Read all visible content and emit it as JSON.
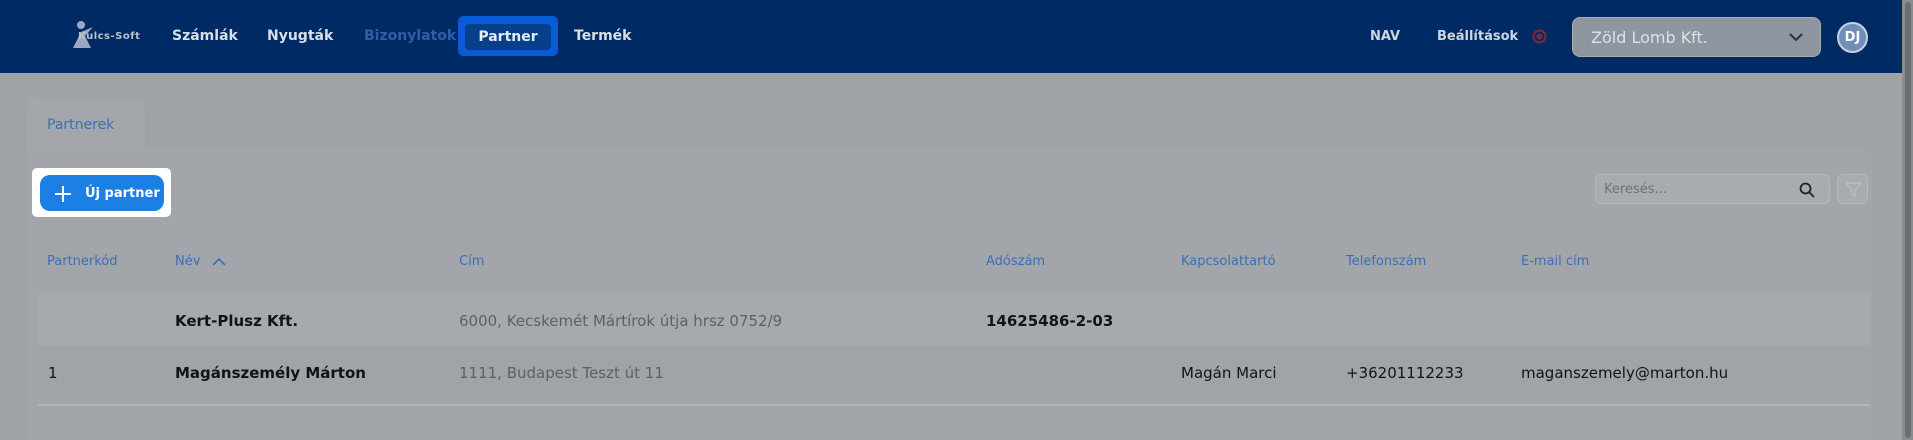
{
  "app": {
    "logo_text": "Kulcs-Soft",
    "nav": [
      {
        "label": "Számlák"
      },
      {
        "label": "Nyugták"
      },
      {
        "label": "Bizonylatok"
      },
      {
        "label": "Partner",
        "active": true
      },
      {
        "label": "Termék"
      }
    ],
    "right": {
      "nav_label": "NAV",
      "settings_label": "Beállítások",
      "company": "Zöld Lomb Kft.",
      "avatar": "DJ"
    }
  },
  "page": {
    "tab_label": "Partnerek",
    "new_button_label": "Új partner",
    "search_placeholder": "Keresés..."
  },
  "table": {
    "columns": [
      "Partnerkód",
      "Név",
      "Cím",
      "Adószám",
      "Kapcsolattartó",
      "Telefonszám",
      "E-mail cím"
    ],
    "sort": {
      "column": "Név",
      "direction": "asc"
    },
    "rows": [
      {
        "code": "",
        "name": "Kert-Plusz Kft.",
        "address": "6000, Kecskemét Mártírok útja hrsz 0752/9",
        "tax": "14625486-2-03",
        "contact": "",
        "phone": "",
        "email": ""
      },
      {
        "code": "1",
        "name": "Magánszemély Márton",
        "address": "1111, Budapest Teszt út 11",
        "tax": "",
        "contact": "Magán Marci",
        "phone": "+36201112233",
        "email": "maganszemely@marton.hu"
      }
    ]
  },
  "colors": {
    "topbar": "#002a63",
    "accent": "#1b7fe4",
    "link": "#3b6fb6"
  },
  "icons": [
    "kulcs-soft-logo-icon",
    "status-dot-icon",
    "chevron-down-icon",
    "plus-icon",
    "search-icon",
    "filter-icon",
    "sort-ascending-icon"
  ]
}
